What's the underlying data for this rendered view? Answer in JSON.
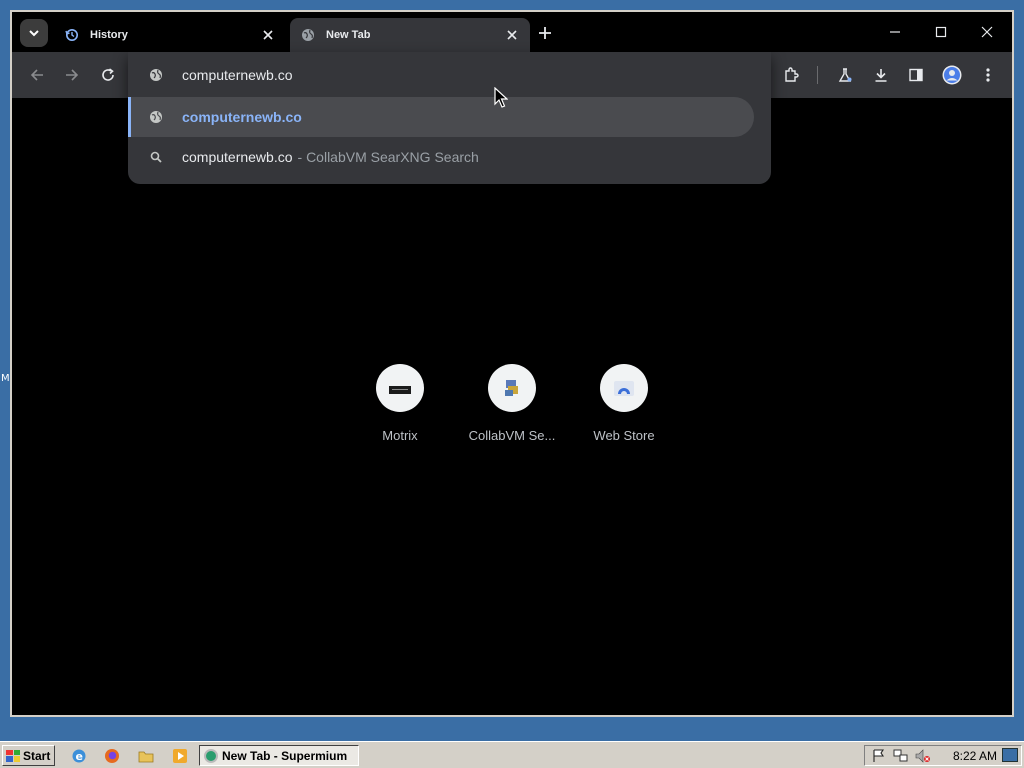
{
  "desktop": {
    "stray_text": "M"
  },
  "tabstrip": {
    "tabs": [
      {
        "title": "History",
        "icon": "history-icon",
        "active": false
      },
      {
        "title": "New Tab",
        "icon": "globe-icon",
        "active": true
      }
    ]
  },
  "omnibox": {
    "input_value": "computernewb.co",
    "suggestions": [
      {
        "text": "computernewb.co",
        "suffix": "",
        "icon": "globe-icon",
        "selected": true
      },
      {
        "text": "computernewb.co",
        "suffix": "- CollabVM SearXNG Search",
        "icon": "search-icon",
        "selected": false
      }
    ]
  },
  "shortcuts": [
    {
      "label": "Motrix",
      "icon": "motrix-icon"
    },
    {
      "label": "CollabVM Se...",
      "icon": "collabvm-icon"
    },
    {
      "label": "Web Store",
      "icon": "web-store-icon"
    }
  ],
  "taskbar": {
    "start_label": "Start",
    "task_button_label": "New Tab - Supermium",
    "clock": "8:22 AM"
  },
  "colors": {
    "accent": "#8ab4f8",
    "toolbar": "#35363a",
    "desktop": "#3a6ea5",
    "taskbar": "#d4d0c8"
  }
}
